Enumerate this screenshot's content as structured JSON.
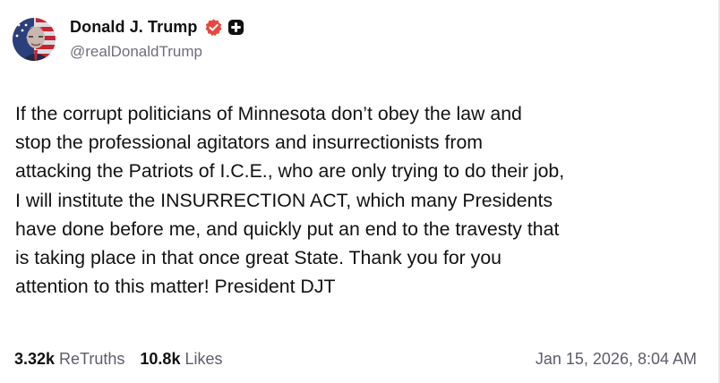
{
  "post": {
    "author": {
      "display_name": "Donald J. Trump",
      "handle": "@realDonaldTrump",
      "avatar_icon": "avatar-flag-portrait",
      "verified_icon": "verified-badge-icon",
      "plus_icon": "plus-badge-icon"
    },
    "text": "If the corrupt politicians of Minnesota don’t obey the law and\nstop the professional agitators and insurrectionists from\nattacking the Patriots of I.C.E., who are only trying to do their job,\nI will institute the INSURRECTION ACT, which many Presidents\nhave done before me, and quickly put an end to the travesty that\nis taking place in that once great State. Thank you for you\nattention to this matter! President DJT",
    "stats": {
      "retruths_count": "3.32k",
      "retruths_label": "ReTruths",
      "likes_count": "10.8k",
      "likes_label": "Likes"
    },
    "timestamp": "Jan 15, 2026, 8:04 AM"
  },
  "colors": {
    "verified_badge": "#e8473f",
    "plus_badge": "#111111",
    "secondary_text": "#5d5d6a"
  }
}
